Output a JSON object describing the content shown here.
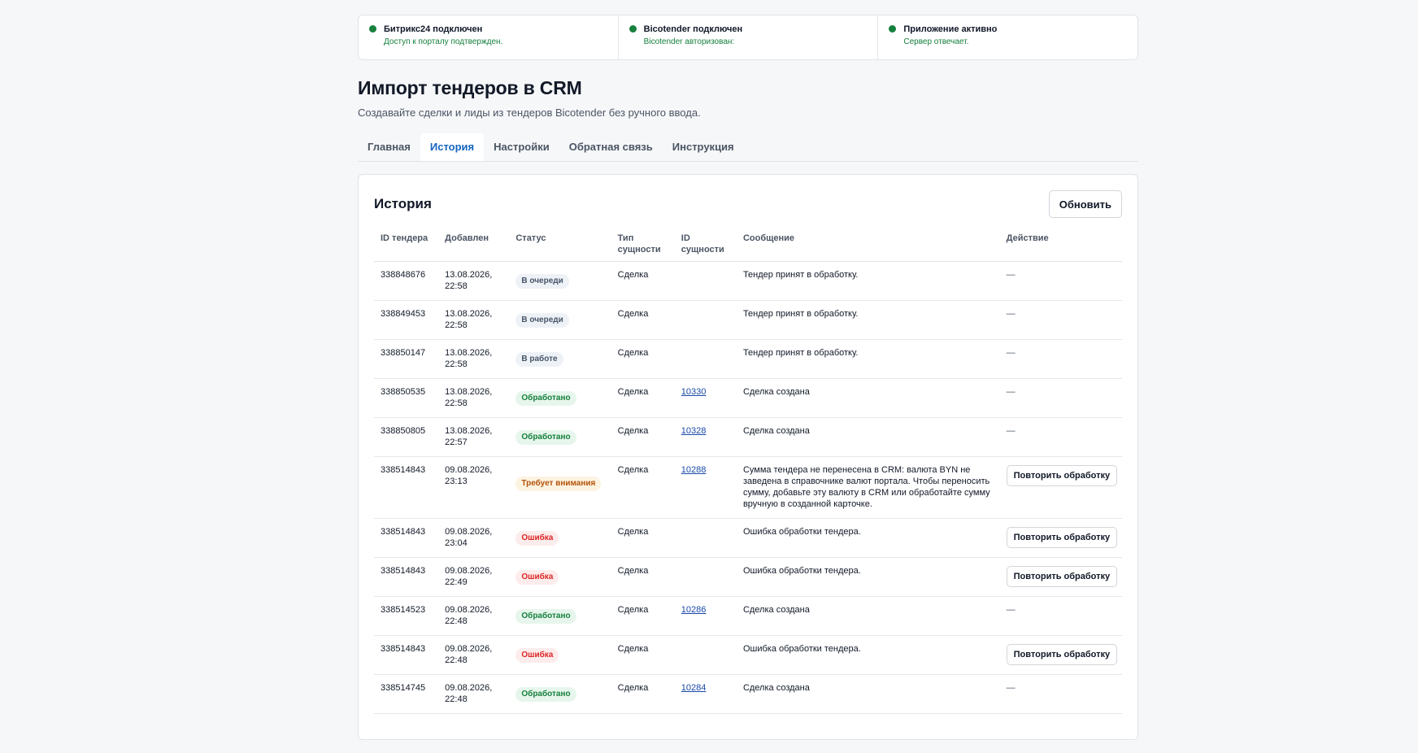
{
  "status_bar": [
    {
      "title": "Битрикс24 подключен",
      "subtitle": "Доступ к порталу подтвержден."
    },
    {
      "title": "Bicotender подключен",
      "subtitle": "Bicotender авторизован:"
    },
    {
      "title": "Приложение активно",
      "subtitle": "Сервер отвечает."
    }
  ],
  "page": {
    "title": "Импорт тендеров в CRM",
    "subtitle": "Создавайте сделки и лиды из тендеров Bicotender без ручного ввода."
  },
  "tabs": [
    {
      "label": "Главная",
      "active": false
    },
    {
      "label": "История",
      "active": true
    },
    {
      "label": "Настройки",
      "active": false
    },
    {
      "label": "Обратная связь",
      "active": false
    },
    {
      "label": "Инструкция",
      "active": false
    }
  ],
  "history": {
    "title": "История",
    "refresh_label": "Обновить",
    "columns": {
      "tender_id": "ID тендера",
      "added": "Добавлен",
      "status": "Статус",
      "entity_type": "Тип сущности",
      "entity_id": "ID сущности",
      "message": "Сообщение",
      "action": "Действие"
    },
    "retry_label": "Повторить обработку",
    "no_action": "—",
    "rows": [
      {
        "tender_id": "338848676",
        "added": "13.08.2026, 22:58",
        "status": "В очереди",
        "status_kind": "queue",
        "entity_type": "Сделка",
        "entity_id": "",
        "message": "Тендер принят в обработку.",
        "retry": false
      },
      {
        "tender_id": "338849453",
        "added": "13.08.2026, 22:58",
        "status": "В очереди",
        "status_kind": "queue",
        "entity_type": "Сделка",
        "entity_id": "",
        "message": "Тендер принят в обработку.",
        "retry": false
      },
      {
        "tender_id": "338850147",
        "added": "13.08.2026, 22:58",
        "status": "В работе",
        "status_kind": "queue",
        "entity_type": "Сделка",
        "entity_id": "",
        "message": "Тендер принят в обработку.",
        "retry": false
      },
      {
        "tender_id": "338850535",
        "added": "13.08.2026, 22:58",
        "status": "Обработано",
        "status_kind": "done",
        "entity_type": "Сделка",
        "entity_id": "10330",
        "message": "Сделка создана",
        "retry": false
      },
      {
        "tender_id": "338850805",
        "added": "13.08.2026, 22:57",
        "status": "Обработано",
        "status_kind": "done",
        "entity_type": "Сделка",
        "entity_id": "10328",
        "message": "Сделка создана",
        "retry": false
      },
      {
        "tender_id": "338514843",
        "added": "09.08.2026, 23:13",
        "status": "Требует внимания",
        "status_kind": "warn",
        "entity_type": "Сделка",
        "entity_id": "10288",
        "message": "Сумма тендера не перенесена в CRM: валюта BYN не заведена в справочнике валют портала. Чтобы переносить сумму, добавьте эту валюту в CRM или обработайте сумму вручную в созданной карточке.",
        "retry": true
      },
      {
        "tender_id": "338514843",
        "added": "09.08.2026, 23:04",
        "status": "Ошибка",
        "status_kind": "err",
        "entity_type": "Сделка",
        "entity_id": "",
        "message": "Ошибка обработки тендера.",
        "retry": true
      },
      {
        "tender_id": "338514843",
        "added": "09.08.2026, 22:49",
        "status": "Ошибка",
        "status_kind": "err",
        "entity_type": "Сделка",
        "entity_id": "",
        "message": "Ошибка обработки тендера.",
        "retry": true
      },
      {
        "tender_id": "338514523",
        "added": "09.08.2026, 22:48",
        "status": "Обработано",
        "status_kind": "done",
        "entity_type": "Сделка",
        "entity_id": "10286",
        "message": "Сделка создана",
        "retry": false
      },
      {
        "tender_id": "338514843",
        "added": "09.08.2026, 22:48",
        "status": "Ошибка",
        "status_kind": "err",
        "entity_type": "Сделка",
        "entity_id": "",
        "message": "Ошибка обработки тендера.",
        "retry": true
      },
      {
        "tender_id": "338514745",
        "added": "09.08.2026, 22:48",
        "status": "Обработано",
        "status_kind": "done",
        "entity_type": "Сделка",
        "entity_id": "10284",
        "message": "Сделка создана",
        "retry": false
      }
    ]
  }
}
